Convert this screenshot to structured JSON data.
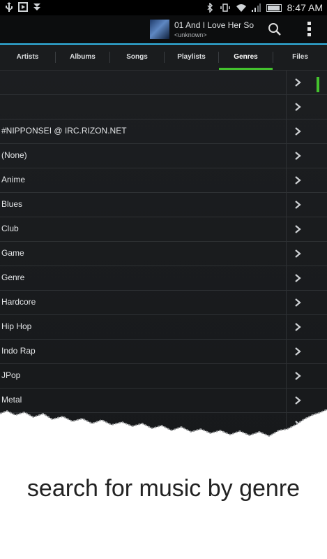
{
  "status_bar": {
    "time": "8:47 AM"
  },
  "now_playing": {
    "title": "01 And I Love Her So",
    "artist": "<unknown>"
  },
  "tabs": [
    {
      "label": "Artists",
      "active": false
    },
    {
      "label": "Albums",
      "active": false
    },
    {
      "label": "Songs",
      "active": false
    },
    {
      "label": "Playlists",
      "active": false
    },
    {
      "label": "Genres",
      "active": true
    },
    {
      "label": "Files",
      "active": false
    }
  ],
  "genres": [
    "",
    "",
    "#NIPPONSEI @ IRC.RIZON.NET",
    "(None)",
    "Anime",
    "Blues",
    "Club",
    "Game",
    "Genre",
    "Hardcore",
    "Hip Hop",
    "Indo Rap",
    "JPop",
    "Metal",
    ""
  ],
  "caption": "search for music by genre",
  "colors": {
    "accent_blue": "#33b5e5",
    "accent_green": "#44c22e",
    "background": "#1d1f22"
  }
}
